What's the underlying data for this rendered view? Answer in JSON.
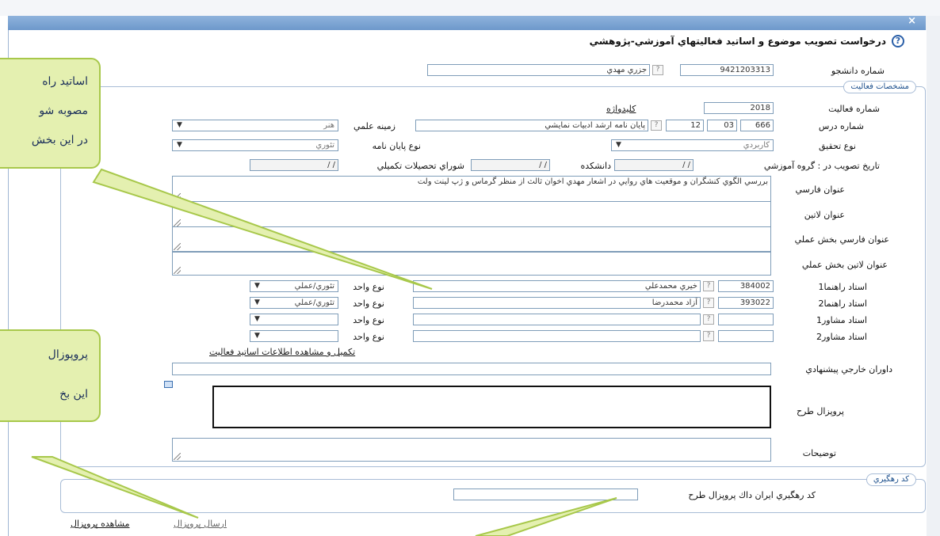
{
  "header": {
    "title": "درخواست تصويب موضوع و اساتيد فعاليتهاي آموزشي-پژوهشي",
    "help_glyph": "?",
    "close_glyph": "×"
  },
  "student": {
    "label": "شماره دانشجو",
    "number": "9421203313",
    "name": "جزري مهدي",
    "q": "?"
  },
  "activity_section": {
    "legend": "مشخصات فعاليت",
    "keyword_link": "كليدواژه",
    "activity_no_label": "شماره فعاليت",
    "activity_no": "2018",
    "course_no_label": "شماره درس",
    "course_a": "666",
    "course_b": "03",
    "course_c": "12",
    "course_q": "?",
    "course_title": "پايان نامه ارشد ادبيات نمايشي",
    "field_label": "زمينه علمي",
    "field_value": "هنر",
    "research_type_label": "نوع تحقيق",
    "research_type_value": "كاربردي",
    "thesis_type_label": "نوع پايان نامه",
    "thesis_type_value": "تئوري",
    "approval_label": "تاريخ تصويب در : گروه آموزشي",
    "faculty_label": "دانشكده",
    "council_label": "شوراي تحصيلات تكميلي",
    "date_placeholder": "/      /",
    "title_fa_label": "عنوان فارسي",
    "title_fa_value": "بررسي الگوي كنشگران و موقعيت هاي روايي در اشعار مهدي اخوان ثالث از منظر گرماس و ژپ لينت ولت",
    "title_latin_label": "عنوان لاتين",
    "practical_fa_label": "عنوان فارسي بخش عملي",
    "practical_latin_label": "عنوان لاتين بخش عملي",
    "unit_type_label": "نوع واحد",
    "advisors": [
      {
        "label": "استاد راهنما1",
        "code": "384002",
        "name": "خيري محمدعلي",
        "unit": "تئوري/عملي"
      },
      {
        "label": "استاد راهنما2",
        "code": "393022",
        "name": "آزاد محمدرضا",
        "unit": "تئوري/عملي"
      },
      {
        "label": "استاد مشاور1",
        "code": "",
        "name": "",
        "unit": ""
      },
      {
        "label": "استاد مشاور2",
        "code": "",
        "name": "",
        "unit": ""
      }
    ],
    "dropdown_glyph": "▼",
    "complete_link": "تكميل و مشاهده اطلاعات اساتيد فعاليت",
    "external_label": "داوران خارجي پيشنهادي",
    "proposal_label": "پروپزال طرح",
    "description_label": "توضيحات"
  },
  "tracking_section": {
    "legend": "كد رهگيري",
    "label": "كد رهگيري ايران داك پروپزال طرح",
    "value": ""
  },
  "footer": {
    "view_proposal": "مشاهده پروپزال",
    "send_proposal": "ارسال پروپزال"
  },
  "callouts": {
    "first": [
      "اساتید راه",
      "مصوبه شو",
      "در این بخش"
    ],
    "second": [
      "پروپوزال",
      "این بخ"
    ]
  },
  "colors": {
    "callout_fill": "#e4f0b0",
    "callout_border": "#a8c84b",
    "titlebar": "#7ba3d4",
    "legend_text": "#1c4f8c"
  }
}
